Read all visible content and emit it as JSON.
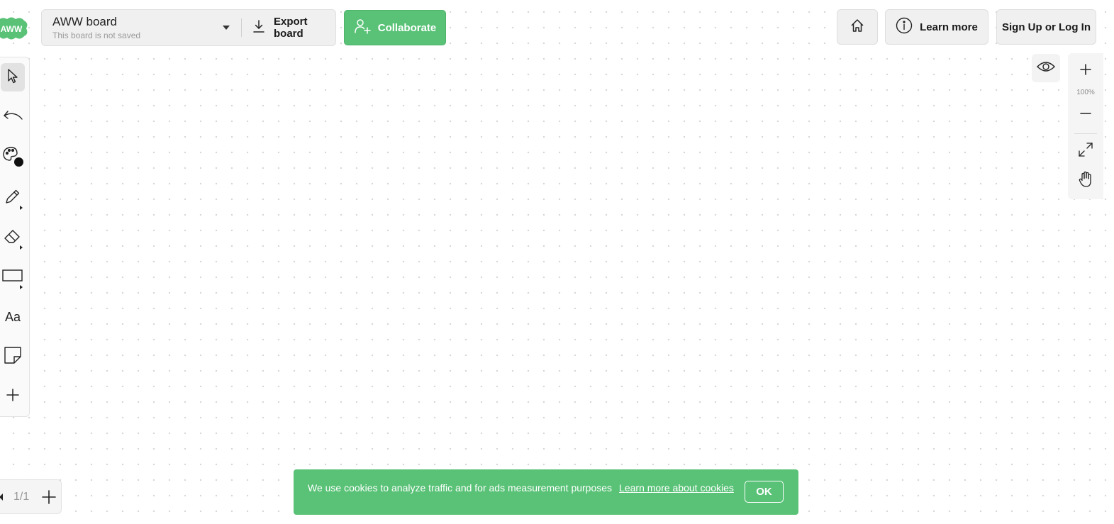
{
  "logo": {
    "text": "AWW",
    "color": "#59c277"
  },
  "board": {
    "name": "AWW board",
    "status": "This board is not saved",
    "export_label": "Export board"
  },
  "collaborate_label": "Collaborate",
  "header": {
    "learn_more_label": "Learn more",
    "signup_label": "Sign Up or Log In"
  },
  "toolbar": {
    "tools": [
      "select-icon",
      "undo-icon",
      "palette-icon",
      "pencil-icon",
      "eraser-icon",
      "rectangle-icon",
      "text-icon",
      "sticky-note-icon",
      "add-icon"
    ],
    "text_tool_label": "Aa",
    "active_color": "#111111"
  },
  "zoom": {
    "level": "100%"
  },
  "pages": {
    "current": "1/1"
  },
  "cookie": {
    "message": "We use cookies to analyze traffic and for ads measurement purposes",
    "link_label": "Learn more about cookies",
    "ok_label": "OK"
  },
  "colors": {
    "accent": "#59c277"
  }
}
